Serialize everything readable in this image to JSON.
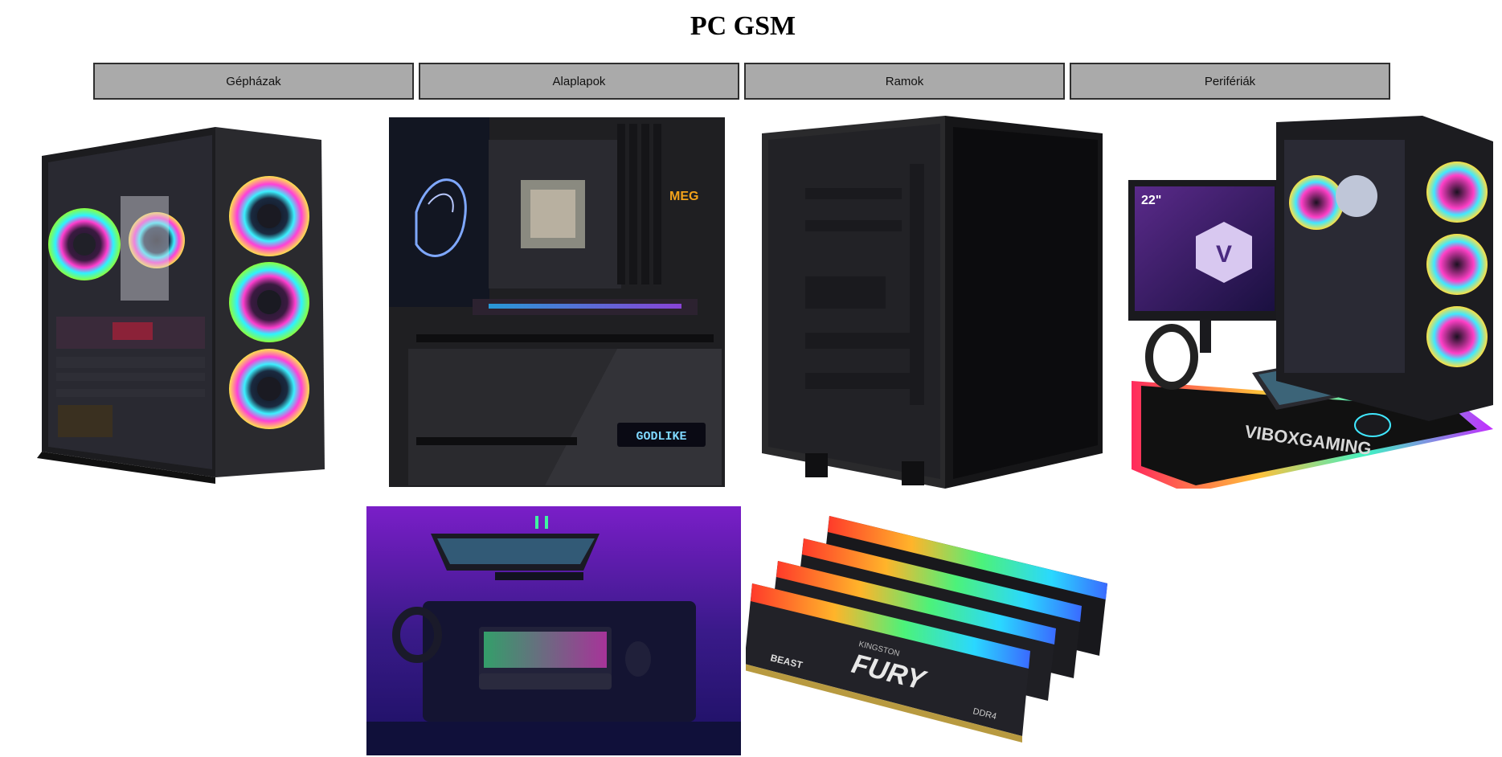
{
  "page": {
    "title": "PC GSM"
  },
  "nav": [
    {
      "label": "Gépházak"
    },
    {
      "label": "Alaplapok"
    },
    {
      "label": "Ramok"
    },
    {
      "label": "Perifériák"
    }
  ],
  "gallery": [
    {
      "subject": "rgb-pc-case"
    },
    {
      "subject": "motherboard"
    },
    {
      "subject": "black-pc-case"
    },
    {
      "subject": "gaming-setup"
    },
    {
      "subject": "desk-setup"
    },
    {
      "subject": "ram-modules"
    }
  ],
  "product_text": {
    "board_badge": "GODLIKE",
    "board_brand": "MEG",
    "monitor_size": "22\"",
    "monitor_logo": "V",
    "mat_brand": "VIBOXGAMING",
    "ram_brand": "KINGSTON",
    "ram_line": "FURY",
    "ram_series": "BEAST",
    "ram_type": "DDR4"
  },
  "colors": {
    "button_bg": "#aaaaaa",
    "button_border": "#2f2f2f"
  }
}
